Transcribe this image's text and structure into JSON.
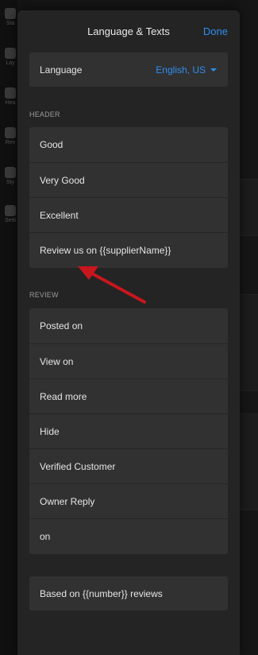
{
  "background_app": {
    "sidebar_items": [
      "Sta",
      "Lay",
      "Hea",
      "Rev",
      "Sty",
      "Setti"
    ]
  },
  "panel": {
    "title": "Language & Texts",
    "done_label": "Done",
    "language": {
      "label": "Language",
      "value": "English, US"
    },
    "sections": [
      {
        "title": "HEADER",
        "items": [
          "Good",
          "Very Good",
          "Excellent",
          "Review us on {{supplierName}}"
        ]
      },
      {
        "title": "REVIEW",
        "items": [
          "Posted on",
          "View on",
          "Read more",
          "Hide",
          "Verified Customer",
          "Owner Reply",
          "on"
        ]
      }
    ],
    "footer_item": "Based on {{number}} reviews"
  },
  "colors": {
    "accent": "#2f8ef0",
    "annotation_arrow": "#c8161d"
  }
}
